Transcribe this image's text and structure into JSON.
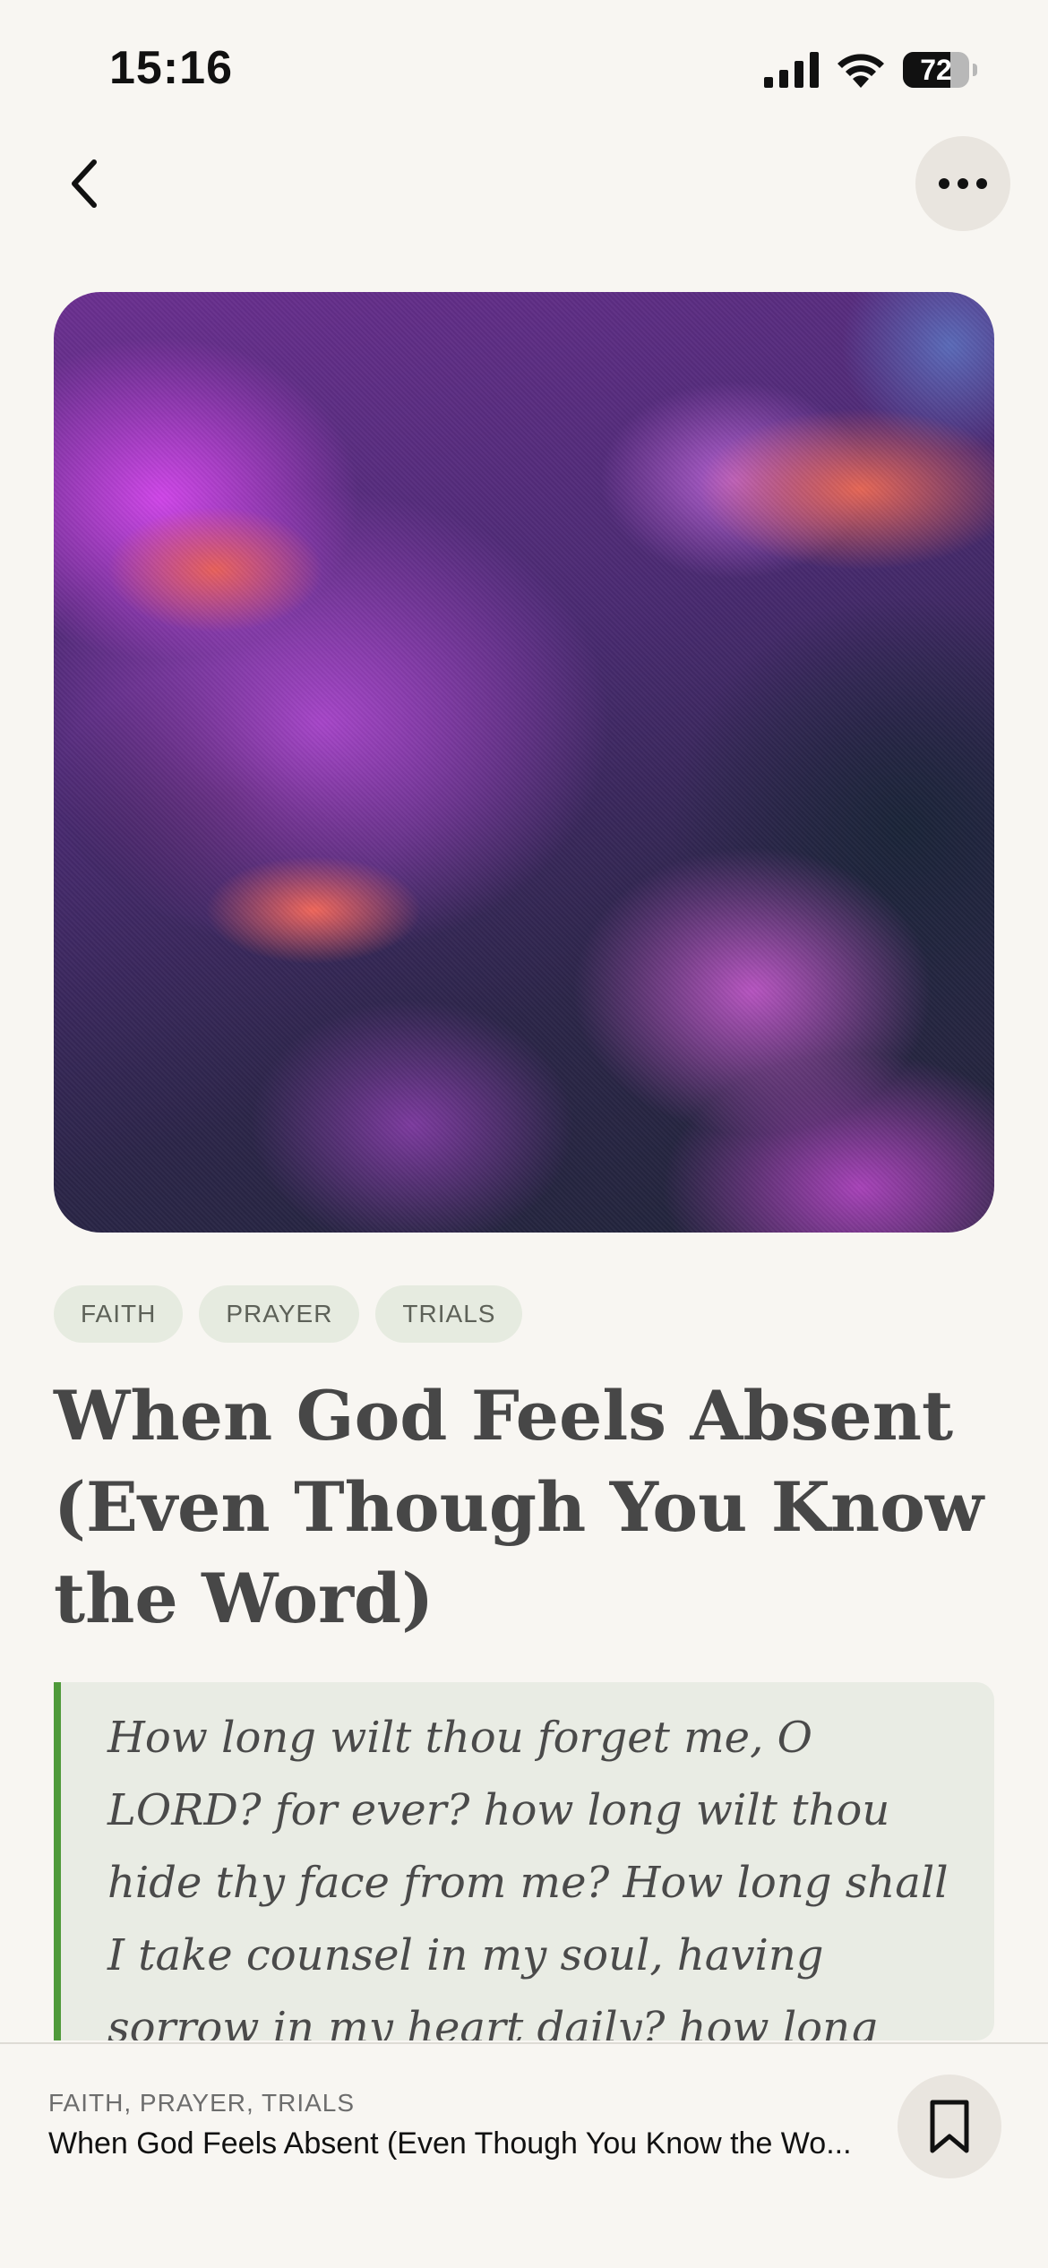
{
  "status_bar": {
    "time": "15:16",
    "battery_percent": 72,
    "battery_label": "72"
  },
  "nav": {
    "back_icon": "chevron-left-icon",
    "more_icon": "ellipsis-icon"
  },
  "artwork": {
    "description_colors": [
      "#cf45e8",
      "#e8605a",
      "#1f2438"
    ]
  },
  "tags": [
    "FAITH",
    "PRAYER",
    "TRIALS"
  ],
  "article": {
    "title": "When God Feels Absent (Even Though You Know the Word)",
    "quote": "How long wilt thou forget me, O LORD? for ever? how long wilt thou hide thy face from me? How long shall I take counsel in my soul, having sorrow in my heart daily? how long shall mine enemy be"
  },
  "mini_player": {
    "tags_line": "FAITH, PRAYER, TRIALS",
    "title": "When God Feels Absent (Even Though You Know the Wo...",
    "bookmark_icon": "bookmark-icon"
  },
  "colors": {
    "background": "#f8f6f2",
    "accent_green": "#4f9a3a",
    "tag_bg": "#e6ebe0"
  }
}
